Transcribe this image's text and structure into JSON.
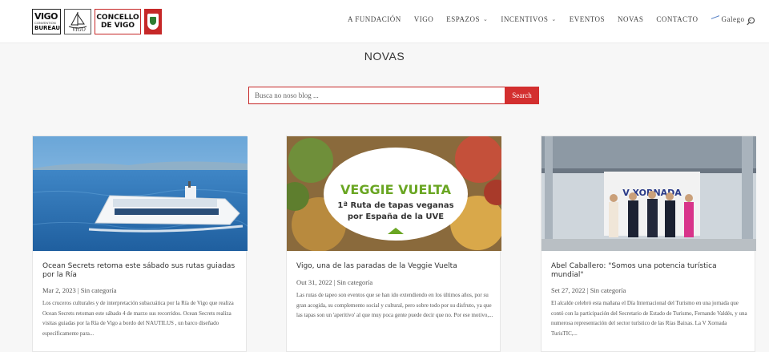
{
  "header": {
    "logos": {
      "vigo_line1": "VIGO",
      "vigo_line2": "CONVENTION",
      "vigo_line3": "BUREAU",
      "ship_text": "VIGO",
      "concello_line1": "CONCELLO",
      "concello_line2": "DE VIGO"
    },
    "nav": [
      {
        "label": "A FUNDACIÓN"
      },
      {
        "label": "VIGO"
      },
      {
        "label": "ESPAZOS"
      },
      {
        "label": "INCENTIVOS"
      },
      {
        "label": "EVENTOS"
      },
      {
        "label": "NOVAS"
      },
      {
        "label": "CONTACTO"
      }
    ],
    "language": "Galego",
    "icons": {
      "search": "search-icon",
      "chevron": "chevron-down-icon",
      "flag": "flag-icon"
    }
  },
  "page": {
    "title": "NOVAS"
  },
  "search": {
    "placeholder": "Busca no noso blog ...",
    "button_label": "Search"
  },
  "colors": {
    "accent": "#d32f2f",
    "background": "#f7f7f7"
  },
  "posts": [
    {
      "title": "Ocean Secrets retoma este sábado sus rutas guiadas por la Ría",
      "meta": "Mar 2, 2023 | Sin categoría",
      "excerpt": "Los cruceros culturales y de interpretación subacuática por la Ría de Vigo que realiza Ocean Secrets retoman este sábado 4 de marzo sus recorridos.  Ocean Secrets realiza visitas guiadas por la Ría de Vigo a bordo del NAUTILUS , un barco diseñado específicamente para..."
    },
    {
      "title": "Vigo, una de las paradas de la Veggie Vuelta",
      "meta": "Out 31, 2022 | Sin categoría",
      "excerpt": "  Las rutas de tapeo son eventos que se han ido extendiendo en los últimos años, por su gran acogida, su complemento social y cultural, pero sobre todo por su disfruto, ya que las tapas son un 'aperitivo' al que muy poca gente puede decir que no. Por ese motivo,...",
      "image_text_1": "VEGGIE VUELTA",
      "image_text_2": "1ª Ruta de tapas veganas",
      "image_text_3": "por España de la UVE"
    },
    {
      "title": "Abel Caballero: \"Somos una potencia turística mundial\"",
      "meta": "Set 27, 2022 | Sin categoría",
      "excerpt": " El alcalde celebró esta mañana el Día Internacional del Turismo en una jornada que contó con la participación del Secretario de Estado de Turismo, Fernando Valdés, y una numerosa representación del sector turístico de las Rías Baixas. La V Xornada TurisTIC,...",
      "image_text_1": "V XORNADA"
    }
  ]
}
